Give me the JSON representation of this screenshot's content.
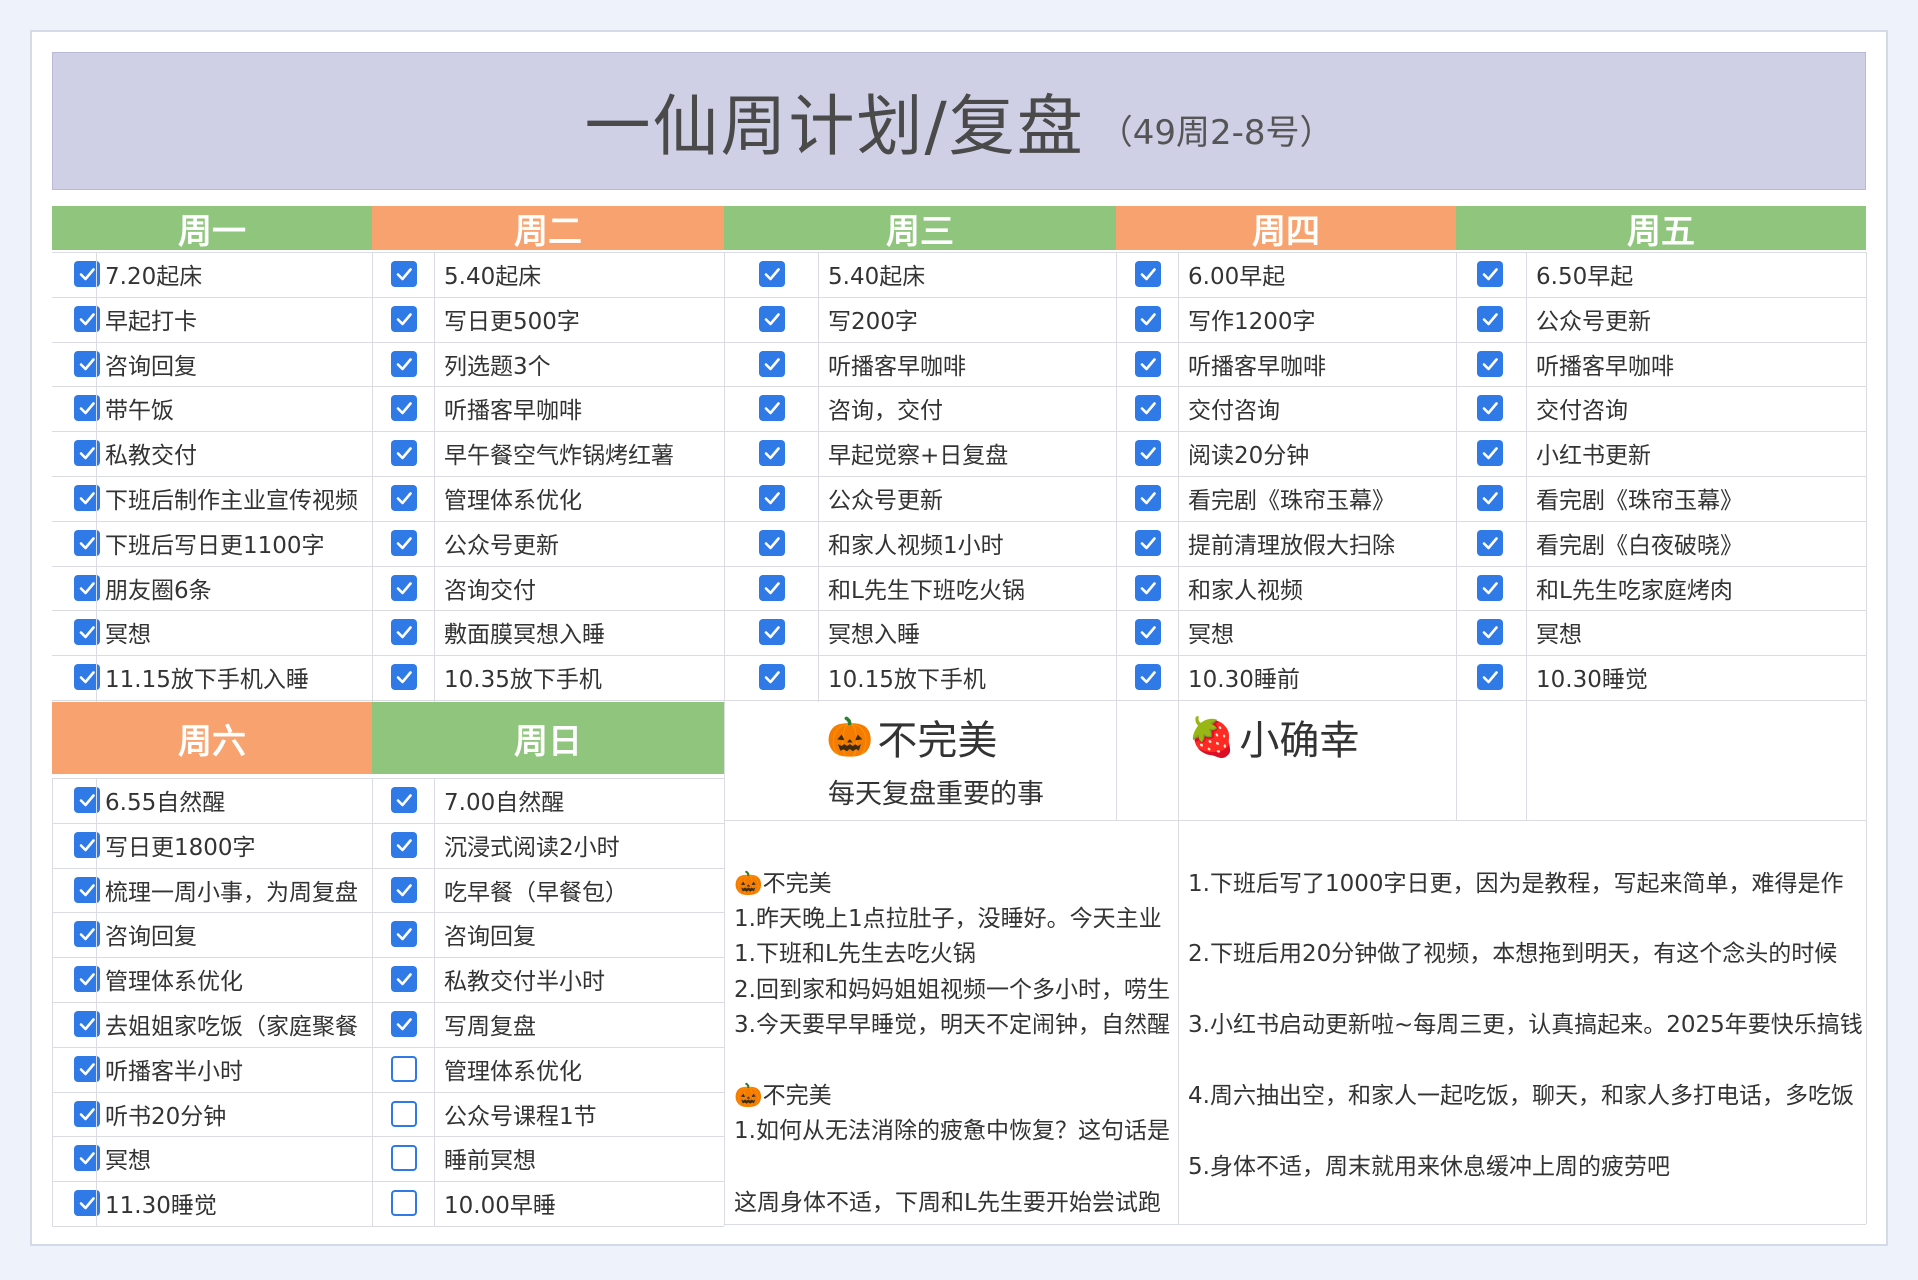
{
  "title": {
    "main": "一仙周计划/复盘",
    "sub": "（49周2-8号）"
  },
  "days": [
    {
      "name": "周一",
      "items": [
        "7.20起床",
        "早起打卡",
        "咨询回复",
        "带午饭",
        "私教交付",
        "下班后制作主业宣传视频",
        "下班后写日更1100字",
        "朋友圈6条",
        "冥想",
        "11.15放下手机入睡"
      ],
      "checked": [
        true,
        true,
        true,
        true,
        true,
        true,
        true,
        true,
        true,
        true
      ]
    },
    {
      "name": "周二",
      "items": [
        "5.40起床",
        "写日更500字",
        "列选题3个",
        "听播客早咖啡",
        "早午餐空气炸锅烤红薯",
        "管理体系优化",
        "公众号更新",
        "咨询交付",
        "敷面膜冥想入睡",
        "10.35放下手机"
      ],
      "checked": [
        true,
        true,
        true,
        true,
        true,
        true,
        true,
        true,
        true,
        true
      ]
    },
    {
      "name": "周三",
      "items": [
        "5.40起床",
        "写200字",
        "听播客早咖啡",
        "咨询，交付",
        "早起觉察+日复盘",
        "公众号更新",
        "和家人视频1小时",
        "和L先生下班吃火锅",
        "冥想入睡",
        "10.15放下手机"
      ],
      "checked": [
        true,
        true,
        true,
        true,
        true,
        true,
        true,
        true,
        true,
        true
      ]
    },
    {
      "name": "周四",
      "items": [
        "6.00早起",
        "写作1200字",
        "听播客早咖啡",
        "交付咨询",
        "阅读20分钟",
        "看完剧《珠帘玉幕》",
        "提前清理放假大扫除",
        "和家人视频",
        "冥想",
        "10.30睡前"
      ],
      "checked": [
        true,
        true,
        true,
        true,
        true,
        true,
        true,
        true,
        true,
        true
      ]
    },
    {
      "name": "周五",
      "items": [
        "6.50早起",
        "公众号更新",
        "听播客早咖啡",
        "交付咨询",
        "小红书更新",
        "看完剧《珠帘玉幕》",
        "看完剧《白夜破晓》",
        "和L先生吃家庭烤肉",
        "冥想",
        "10.30睡觉"
      ],
      "checked": [
        true,
        true,
        true,
        true,
        true,
        true,
        true,
        true,
        true,
        true
      ]
    },
    {
      "name": "周六",
      "items": [
        "6.55自然醒",
        "写日更1800字",
        "梳理一周小事，为周复盘",
        "咨询回复",
        "管理体系优化",
        "去姐姐家吃饭（家庭聚餐",
        "听播客半小时",
        "听书20分钟",
        "冥想",
        "11.30睡觉"
      ],
      "checked": [
        true,
        true,
        true,
        true,
        true,
        true,
        true,
        true,
        true,
        true
      ]
    },
    {
      "name": "周日",
      "items": [
        "7.00自然醒",
        "沉浸式阅读2小时",
        "吃早餐（早餐包）",
        "咨询回复",
        "私教交付半小时",
        "写周复盘",
        "管理体系优化",
        "公众号课程1节",
        "睡前冥想",
        "10.00早睡"
      ],
      "checked": [
        true,
        true,
        true,
        true,
        true,
        true,
        false,
        false,
        false,
        false
      ]
    }
  ],
  "imperfect": {
    "emoji": "🎃",
    "title": "不完美",
    "subtitle": "每天复盘重要的事",
    "block1_title": "不完美",
    "block1": [
      "1.昨天晚上1点拉肚子，没睡好。今天主业",
      "1.下班和L先生去吃火锅",
      "2.回到家和妈妈姐姐视频一个多小时，唠生",
      "3.今天要早早睡觉，明天不定闹钟，自然醒"
    ],
    "block2_title": "不完美",
    "block2": [
      "1.如何从无法消除的疲惫中恢复？这句话是"
    ],
    "closing": "这周身体不适，下周和L先生要开始尝试跑"
  },
  "happiness": {
    "emoji": "🍓",
    "title": "小确幸",
    "lines": [
      "1.下班后写了1000字日更，因为是教程，写起来简单，难得是作",
      "2.下班后用20分钟做了视频，本想拖到明天，有这个念头的时候",
      "3.小红书启动更新啦~每周三更，认真搞起来。2025年要快乐搞钱",
      "4.周六抽出空，和家人一起吃饭，聊天，和家人多打电话，多吃饭",
      "5.身体不适，周末就用来休息缓冲上周的疲劳吧"
    ]
  },
  "colors": {
    "green": "#8fc57c",
    "orange": "#f7a26f",
    "checkbox": "#2f7ae6",
    "title_bg": "#cfd0e6"
  }
}
